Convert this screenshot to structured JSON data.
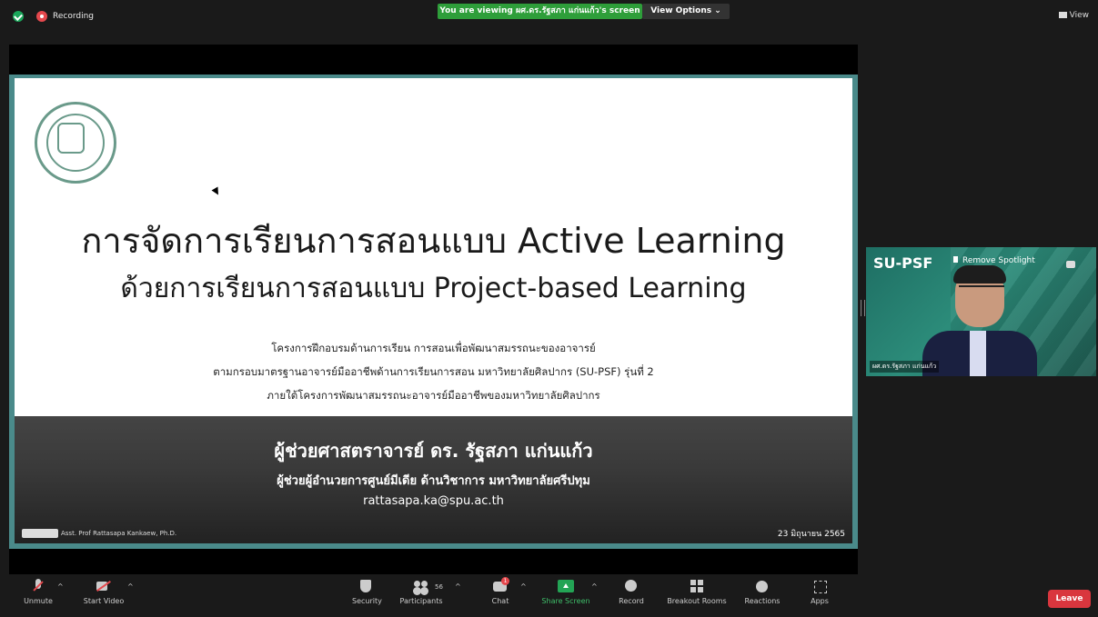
{
  "topbar": {
    "recording_label": "Recording",
    "viewing_banner": "You are viewing ผศ.ดร.รัฐสภา แก่นแก้ว's screen",
    "view_options_label": "View Options ⌄",
    "view_label": "View"
  },
  "slide": {
    "title_line1": "การจัดการเรียนการสอนแบบ Active Learning",
    "title_line2": "ด้วยการเรียนการสอนแบบ Project-based Learning",
    "sub_lines": [
      "โครงการฝึกอบรมด้านการเรียน การสอนเพื่อพัฒนาสมรรถนะของอาจารย์",
      "ตามกรอบมาตรฐานอาจารย์มืออาชีพด้านการเรียนการสอน มหาวิทยาลัยศิลปากร (SU-PSF) รุ่นที่ 2",
      "ภายใต้โครงการพัฒนาสมรรถนะอาจารย์มืออาชีพของมหาวิทยาลัยศิลปากร"
    ],
    "presenter_name": "ผู้ช่วยศาสตราจารย์ ดร. รัฐสภา แก่นแก้ว",
    "presenter_role": "ผู้ช่วยผู้อำนวยการศูนย์มีเดีย ด้านวิชาการ มหาวิทยาลัยศรีปทุม",
    "presenter_email": "rattasapa.ka@spu.ac.th",
    "footer_left": "Asst. Prof Rattasapa Kankaew, Ph.D.",
    "footer_date": "23 มิถุนายน 2565"
  },
  "video_tile": {
    "bg_text": "SU-PSF",
    "remove_spotlight": "Remove Spotlight",
    "participant_name": "ผศ.ดร.รัฐสภา แก่นแก้ว"
  },
  "toolbar": {
    "unmute": "Unmute",
    "start_video": "Start Video",
    "security": "Security",
    "participants": "Participants",
    "participants_count": "56",
    "chat": "Chat",
    "chat_badge": "1",
    "share_screen": "Share Screen",
    "record": "Record",
    "breakout_rooms": "Breakout Rooms",
    "reactions": "Reactions",
    "apps": "Apps",
    "leave": "Leave"
  },
  "colors": {
    "share_green": "#23a455",
    "leave_red": "#d9363e",
    "banner_green": "#2e9e3a",
    "slide_border": "#4a8a8a"
  }
}
